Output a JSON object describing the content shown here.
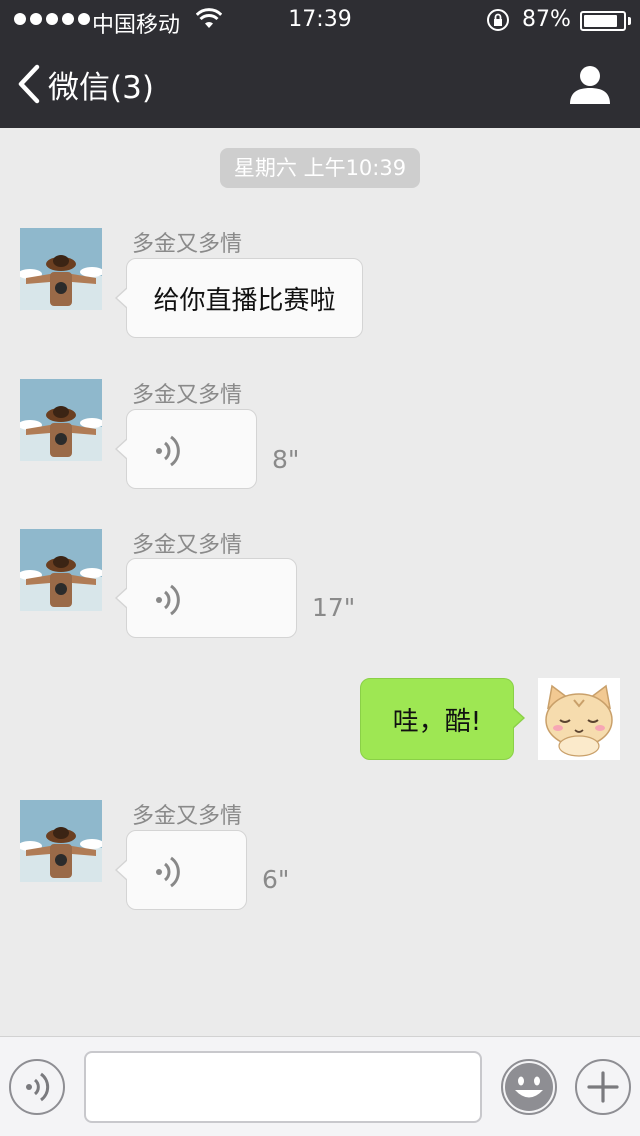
{
  "status_bar": {
    "carrier": "中国移动",
    "time": "17:39",
    "battery_text": "87%",
    "battery_level": 0.87,
    "icons": [
      "signal-dots",
      "wifi-icon",
      "rotation-lock-icon",
      "battery-icon"
    ]
  },
  "nav": {
    "back_label": "微信(3)",
    "back_icon": "chevron-left-icon",
    "profile_icon": "person-icon"
  },
  "chat": {
    "timestamp": "星期六 上午10:39",
    "messages": [
      {
        "side": "left",
        "sender": "多金又多情",
        "type": "text",
        "text": "给你直播比赛啦"
      },
      {
        "side": "left",
        "sender": "多金又多情",
        "type": "voice",
        "duration": "8\""
      },
      {
        "side": "left",
        "sender": "多金又多情",
        "type": "voice",
        "duration": "17\""
      },
      {
        "side": "right",
        "type": "text",
        "text": "哇，酷!"
      },
      {
        "side": "left",
        "sender": "多金又多情",
        "type": "voice",
        "duration": "6\""
      }
    ]
  },
  "input_bar": {
    "voice_icon": "voice-toggle-icon",
    "text_value": "",
    "emoji_icon": "emoji-icon",
    "plus_icon": "plus-icon"
  },
  "colors": {
    "header_bg": "#2e2e33",
    "chat_bg": "#ebebeb",
    "incoming_bubble": "#fafafa",
    "outgoing_bubble": "#9ee753"
  }
}
